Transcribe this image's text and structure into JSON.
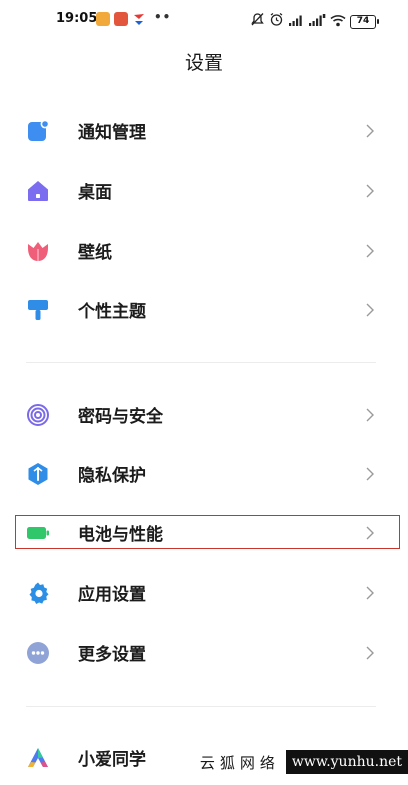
{
  "status_bar": {
    "time": "19:05",
    "dots": "••",
    "battery": "74"
  },
  "header": {
    "title": "设置"
  },
  "settings": [
    {
      "label": "通知管理",
      "icon": "notification-icon",
      "color": "#3d8ef0"
    },
    {
      "label": "桌面",
      "icon": "home-icon",
      "color": "#7b6cf0"
    },
    {
      "label": "壁纸",
      "icon": "tulip-icon",
      "color": "#ef5f79"
    },
    {
      "label": "个性主题",
      "icon": "brush-icon",
      "color": "#2f8de8"
    },
    {
      "label": "密码与安全",
      "icon": "fingerprint-icon",
      "color": "#7a6ae8"
    },
    {
      "label": "隐私保护",
      "icon": "shield-icon",
      "color": "#2f8de8"
    },
    {
      "label": "电池与性能",
      "icon": "battery-icon",
      "color": "#30c66a"
    },
    {
      "label": "应用设置",
      "icon": "gear-icon",
      "color": "#2b8fe6"
    },
    {
      "label": "更多设置",
      "icon": "more-icon",
      "color": "#7a90c8"
    },
    {
      "label": "小爱同学",
      "icon": "xiaoai-icon",
      "color": "#5a6cf0"
    }
  ],
  "watermark": {
    "cn": "云狐网络",
    "url": "www.yunhu.net"
  }
}
